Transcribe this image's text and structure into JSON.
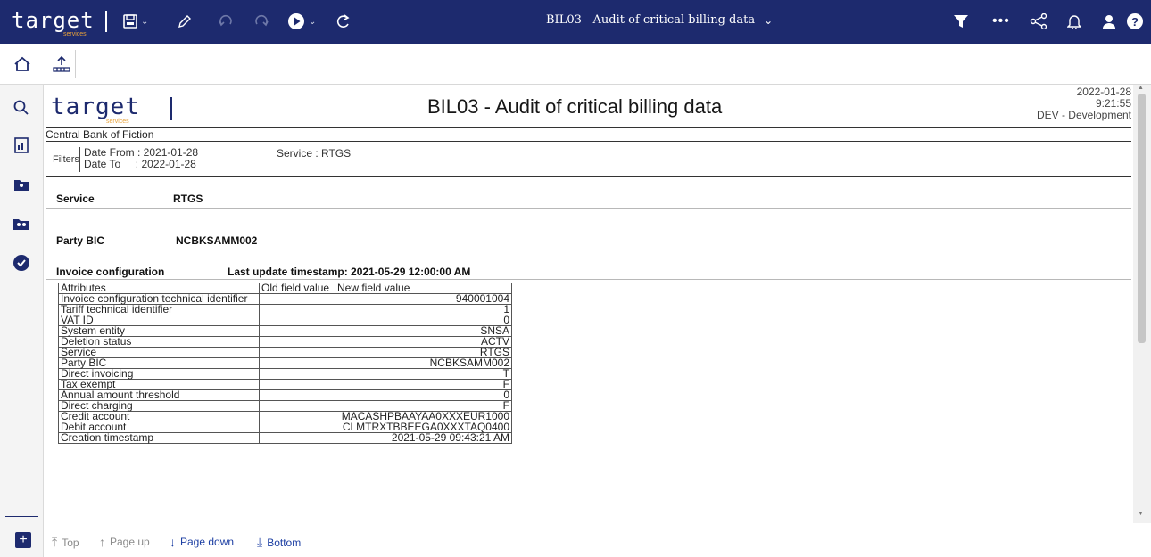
{
  "app": {
    "logo_text": "target",
    "logo_sub": "services",
    "window_title": "BIL03 - Audit of critical billing data"
  },
  "report": {
    "logo_text": "target",
    "logo_sub": "services",
    "title": "BIL03 - Audit of critical billing data",
    "date": "2022-01-28",
    "time": "9:21:55",
    "environment": "DEV - Development",
    "bank": "Central Bank of Fiction",
    "filters": {
      "label": "Filters",
      "date_from": "Date From : 2021-01-28",
      "date_to": "Date To     : 2022-01-28",
      "service": "Service : RTGS"
    },
    "service_label": "Service",
    "service_value": "RTGS",
    "party_bic_label": "Party BIC",
    "party_bic_value": "NCBKSAMM002",
    "invoice_label": "Invoice configuration",
    "last_update": "Last update timestamp: 2021-05-29 12:00:00 AM",
    "table": {
      "headers": [
        "Attributes",
        "Old field value",
        "New field value"
      ],
      "rows": [
        [
          "Invoice configuration technical identifier",
          "",
          "940001004"
        ],
        [
          "Tariff technical identifier",
          "",
          "1"
        ],
        [
          "VAT ID",
          "",
          "0"
        ],
        [
          "System entity",
          "",
          "SNSA"
        ],
        [
          "Deletion status",
          "",
          "ACTV"
        ],
        [
          "Service",
          "",
          "RTGS"
        ],
        [
          "Party BIC",
          "",
          "NCBKSAMM002"
        ],
        [
          "Direct invoicing",
          "",
          "T"
        ],
        [
          "Tax exempt",
          "",
          "F"
        ],
        [
          "Annual amount threshold",
          "",
          "0"
        ],
        [
          "Direct charging",
          "",
          "F"
        ],
        [
          "Credit account",
          "",
          "MACASHPBAAYAA0XXXEUR1000"
        ],
        [
          "Debit account",
          "",
          "CLMTRXTBBEEGA0XXXTAQ0400"
        ],
        [
          "Creation timestamp",
          "",
          "2021-05-29 09:43:21 AM"
        ]
      ]
    }
  },
  "footer": {
    "top": "Top",
    "page_up": "Page up",
    "page_down": "Page down",
    "bottom": "Bottom"
  },
  "icons": {
    "toolbar": [
      "save-icon",
      "edit-icon",
      "undo-icon",
      "redo-icon",
      "run-icon",
      "refresh-icon"
    ],
    "right": [
      "filter-icon",
      "more-icon",
      "share-icon",
      "bell-icon",
      "user-icon",
      "help-icon"
    ],
    "rail": [
      "home-icon",
      "search-icon",
      "report-icon",
      "folder-icon",
      "team-folder-icon",
      "check-icon",
      "add-icon"
    ]
  },
  "colors": {
    "brand": "#1d2a6e",
    "accent": "#e8a23a",
    "link": "#1d3fa3"
  }
}
